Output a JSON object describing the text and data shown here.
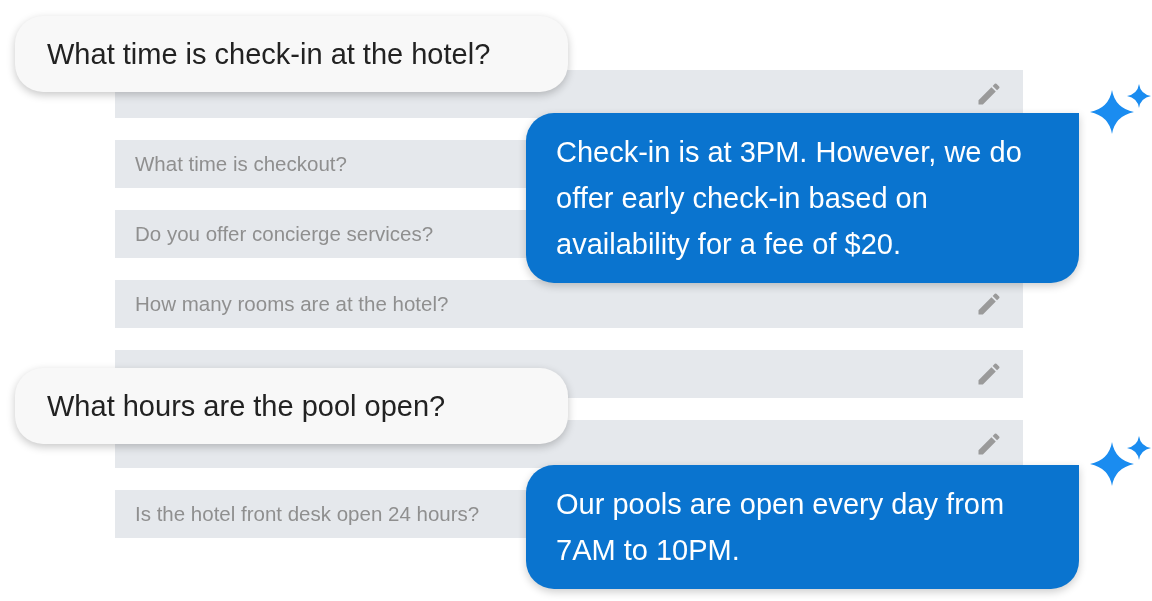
{
  "questions": [
    {
      "edit_icon": true
    },
    {
      "text": "What time is checkout?",
      "edit_icon": false
    },
    {
      "text": "Do you offer concierge services?",
      "edit_icon": false
    },
    {
      "text": "How many rooms are at the hotel?",
      "edit_icon": true
    },
    {
      "edit_icon": true
    },
    {
      "edit_icon": true
    },
    {
      "text": "Is the hotel front desk open 24 hours?",
      "edit_icon": false
    }
  ],
  "messages": [
    {
      "kind": "question",
      "text": "What time is check-in at the hotel?"
    },
    {
      "kind": "answer",
      "text": "Check-in is at 3PM. However, we do offer early check-in based on availability for a fee of $20."
    },
    {
      "kind": "question",
      "text": "What hours are the pool open?"
    },
    {
      "kind": "answer",
      "text": "Our pools are open every day from 7AM to 10PM."
    }
  ]
}
